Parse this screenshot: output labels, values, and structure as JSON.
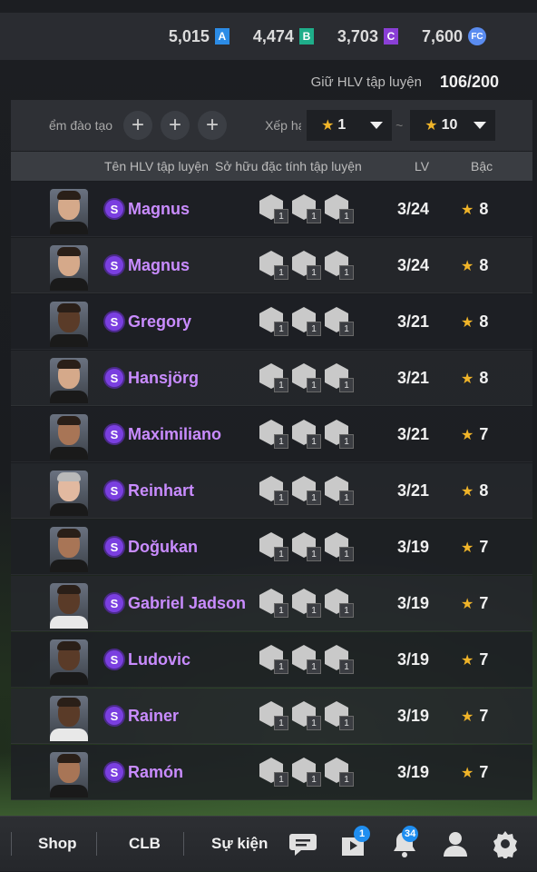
{
  "currencies": [
    {
      "value": "5,015",
      "icon": "A",
      "color": "#2c8ce6"
    },
    {
      "value": "4,474",
      "icon": "B",
      "color": "#1fae8a"
    },
    {
      "value": "3,703",
      "icon": "C",
      "color": "#8a3fd6"
    },
    {
      "value": "7,600",
      "icon": "FC",
      "color": "#5a8cf0"
    }
  ],
  "trainer_count": {
    "label": "Giữ HLV tập luyện",
    "value": "106/200"
  },
  "filter": {
    "training_label": "ểm đào tạo",
    "rank_label": "Xếp hạ",
    "rank_from": "1",
    "rank_to": "10",
    "separator": "~"
  },
  "table_header": {
    "name": "Tên HLV tập luyện",
    "traits": "Sở hữu đặc tính tập luyện",
    "lv": "LV",
    "grade": "Bậc"
  },
  "rows": [
    {
      "name": "Magnus",
      "lv": "3/24",
      "grade": "8",
      "traits": [
        "1",
        "1",
        "1"
      ]
    },
    {
      "name": "Magnus",
      "lv": "3/24",
      "grade": "8",
      "traits": [
        "1",
        "1",
        "1"
      ]
    },
    {
      "name": "Gregory",
      "lv": "3/21",
      "grade": "8",
      "traits": [
        "1",
        "1",
        "1"
      ]
    },
    {
      "name": "Hansjörg",
      "lv": "3/21",
      "grade": "8",
      "traits": [
        "1",
        "1",
        "1"
      ]
    },
    {
      "name": "Maximiliano",
      "lv": "3/21",
      "grade": "7",
      "traits": [
        "1",
        "1",
        "1"
      ]
    },
    {
      "name": "Reinhart",
      "lv": "3/21",
      "grade": "8",
      "traits": [
        "1",
        "1",
        "1"
      ]
    },
    {
      "name": "Doğukan",
      "lv": "3/19",
      "grade": "7",
      "traits": [
        "1",
        "1",
        "1"
      ]
    },
    {
      "name": "Gabriel Jadson",
      "lv": "3/19",
      "grade": "7",
      "traits": [
        "1",
        "1",
        "1"
      ]
    },
    {
      "name": "Ludovic",
      "lv": "3/19",
      "grade": "7",
      "traits": [
        "1",
        "1",
        "1"
      ]
    },
    {
      "name": "Rainer",
      "lv": "3/19",
      "grade": "7",
      "traits": [
        "1",
        "1",
        "1"
      ]
    },
    {
      "name": "Ramón",
      "lv": "3/19",
      "grade": "7",
      "traits": [
        "1",
        "1",
        "1"
      ]
    }
  ],
  "rank_badge": "S",
  "bottom_nav": {
    "shop": "Shop",
    "club": "CLB",
    "events": "Sự kiện",
    "flag_badge": "1",
    "bell_badge": "34"
  }
}
